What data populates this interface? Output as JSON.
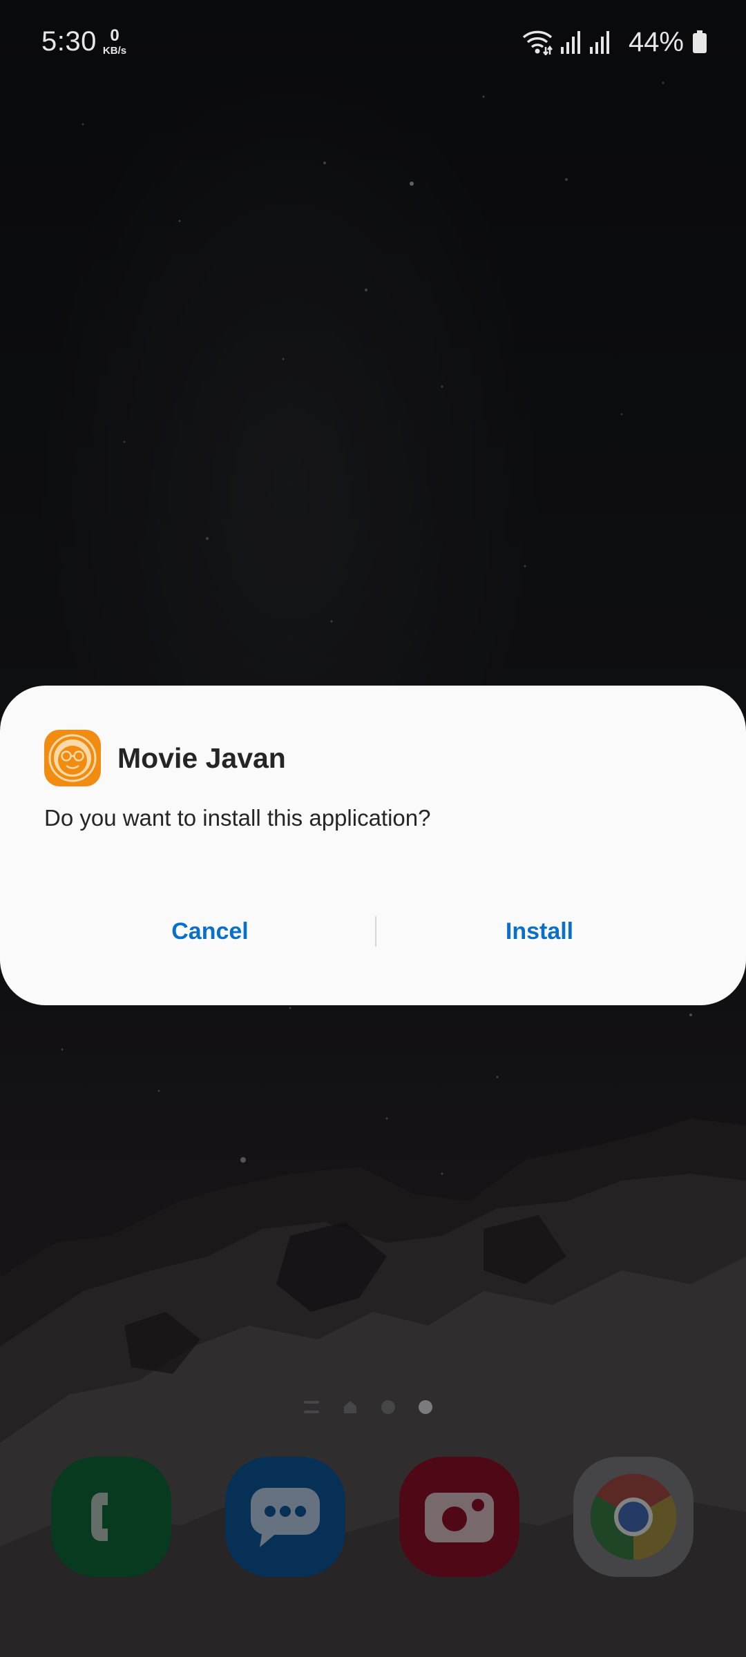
{
  "status_bar": {
    "time": "5:30",
    "net_speed_value": "0",
    "net_speed_unit": "KB/s",
    "battery_percent": "44%",
    "icons": [
      "wifi-icon",
      "signal-sim1-icon",
      "signal-sim2-icon",
      "battery-icon"
    ]
  },
  "dialog": {
    "app_name": "Movie Javan",
    "app_icon": "movie-javan-app-icon",
    "message": "Do you want to install this application?",
    "cancel_label": "Cancel",
    "install_label": "Install",
    "accent_color": "#0a6fc9",
    "app_icon_color": "#f28c10"
  },
  "home": {
    "page_indicator": {
      "pages": [
        "apps-list",
        "home",
        "page-3",
        "page-4"
      ],
      "active_index": 3
    },
    "dock": [
      {
        "name": "phone-app",
        "icon": "phone-icon",
        "color": "#0c5a30"
      },
      {
        "name": "messages-app",
        "icon": "message-bubble-icon",
        "color": "#0b4b86"
      },
      {
        "name": "camera-app",
        "icon": "camera-icon",
        "color": "#7a0f22"
      },
      {
        "name": "chrome-app",
        "icon": "chrome-icon",
        "color": "#6b6b6e"
      }
    ]
  }
}
